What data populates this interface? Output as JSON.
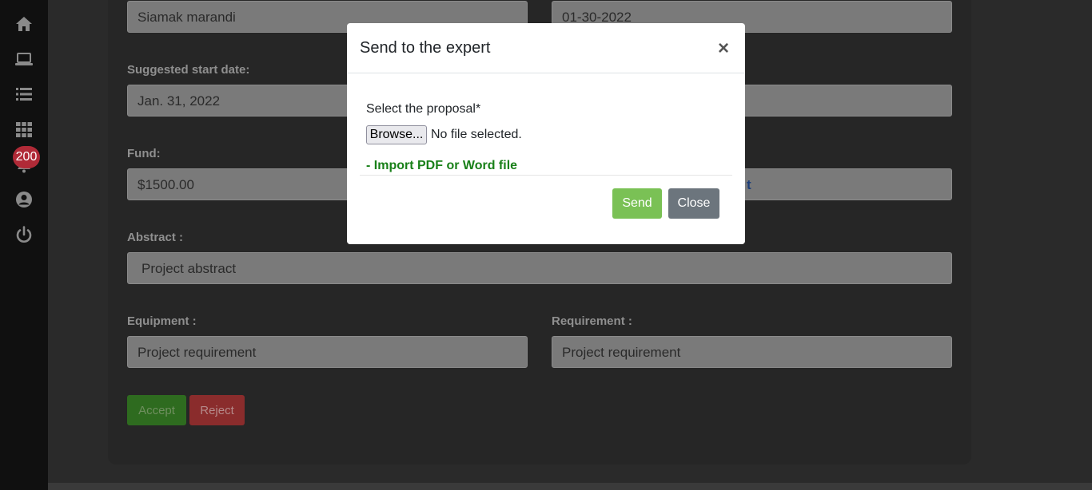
{
  "sidebar": {
    "icons": [
      "home-icon",
      "laptop-icon",
      "list-icon",
      "grid-icon",
      "bell-icon",
      "user-circle-icon",
      "power-icon"
    ],
    "notification_count": "200"
  },
  "form": {
    "name_value": "Siamak marandi",
    "date_value": "01-30-2022",
    "start_date_label": "Suggested start date:",
    "start_date_value": "Jan. 31, 2022",
    "fund_label": "Fund:",
    "fund_value": "$1500.00",
    "link_fragment": "t",
    "abstract_label": "Abstract :",
    "abstract_value": "Project  abstract",
    "equipment_label": "Equipment :",
    "equipment_value": "Project requirement",
    "requirement_label": "Requirement :",
    "requirement_value": "Project requirement",
    "accept_label": "Accept",
    "reject_label": "Reject"
  },
  "modal": {
    "title": "Send to the expert",
    "close_symbol": "×",
    "proposal_label": "Select the proposal*",
    "browse_label": "Browse...",
    "file_status": "No file selected.",
    "import_hint": "- Import PDF or Word file",
    "send_label": "Send",
    "close_label": "Close"
  },
  "colors": {
    "sidebar_bg": "#101010",
    "badge": "#b02a37",
    "send": "#7ac155",
    "close": "#6c757d",
    "hint": "#198019"
  }
}
